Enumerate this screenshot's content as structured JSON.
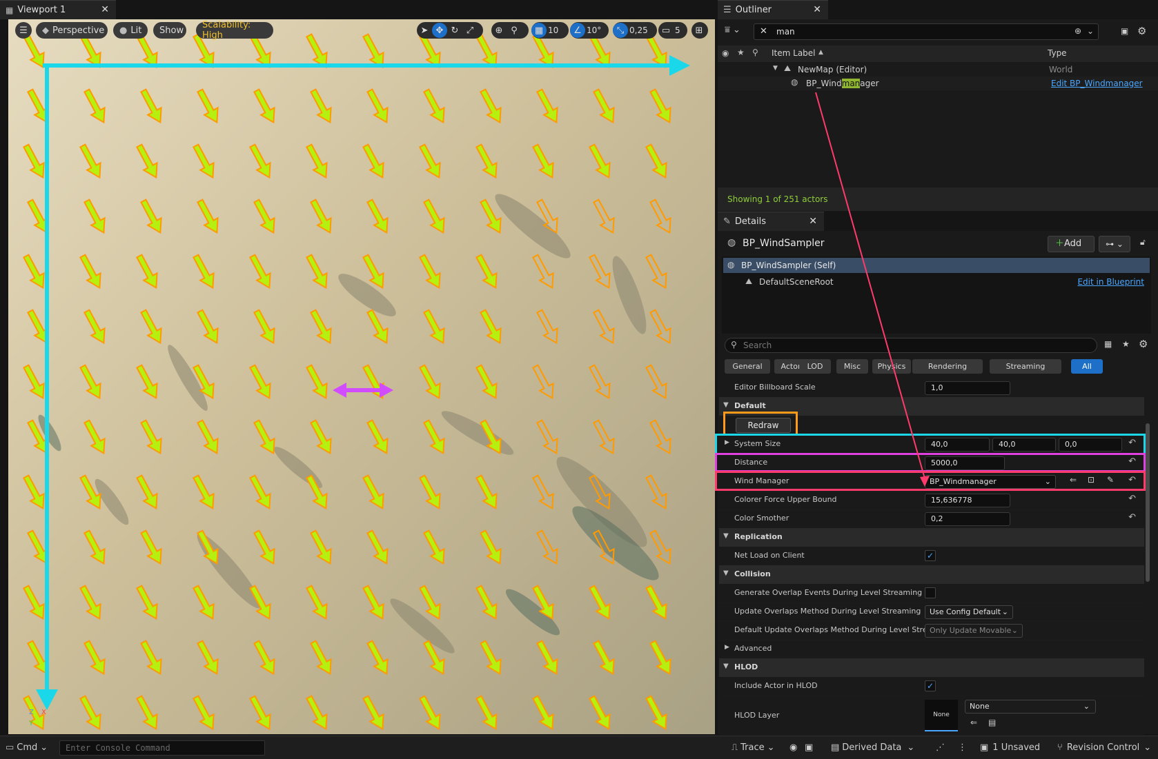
{
  "viewport": {
    "tab_title": "Viewport 1",
    "menu_icon": "hamburger-icon",
    "perspective_label": "Perspective",
    "lit_label": "Lit",
    "show_label": "Show",
    "scalability_label": "Scalability: High",
    "grid_snap_value": "10",
    "rotation_snap_value": "10°",
    "scale_snap_value": "0,25",
    "camera_speed_value": "5",
    "axis_labels": {
      "z": "Z",
      "x": "X",
      "y": "Y"
    },
    "arrow_colors": {
      "fill": "#b5f010",
      "outline": "#ff9a00",
      "cyan": "#1ad8ea",
      "magenta": "#d24cff"
    }
  },
  "outliner": {
    "tab_title": "Outliner",
    "search_value": "man",
    "col_item_label": "Item Label",
    "col_type": "Type",
    "rows": [
      {
        "label": "NewMap (Editor)",
        "type": "World"
      },
      {
        "label_pre": "BP_Wind",
        "label_match": "man",
        "label_post": "ager",
        "type": "Edit BP_Windmanager"
      }
    ],
    "count_text": "Showing 1 of 251 actors"
  },
  "details": {
    "tab_title": "Details",
    "object_name": "BP_WindSampler",
    "add_label": "Add",
    "components": [
      {
        "label": "BP_WindSampler (Self)"
      },
      {
        "label": "DefaultSceneRoot",
        "link": "Edit in Blueprint"
      }
    ],
    "search_placeholder": "Search",
    "filter_tabs": [
      "General",
      "Actor",
      "LOD",
      "Misc",
      "Physics",
      "Rendering",
      "Streaming",
      "All"
    ],
    "editor_billboard_scale": {
      "label": "Editor Billboard Scale",
      "value": "1,0"
    },
    "default_section": "Default",
    "redraw_label": "Redraw",
    "system_size": {
      "label": "System Size",
      "x": "40,0",
      "y": "40,0",
      "z": "0,0"
    },
    "distance": {
      "label": "Distance",
      "value": "5000,0"
    },
    "wind_manager": {
      "label": "Wind Manager",
      "value": "BP_Windmanager"
    },
    "colorer_force": {
      "label": "Colorer Force Upper Bound",
      "value": "15,636778"
    },
    "color_smother": {
      "label": "Color Smother",
      "value": "0,2"
    },
    "replication_section": "Replication",
    "net_load": {
      "label": "Net Load on Client",
      "checked": true
    },
    "collision_section": "Collision",
    "gen_overlap": {
      "label": "Generate Overlap Events During Level Streaming",
      "checked": false
    },
    "update_overlaps": {
      "label": "Update Overlaps Method During Level Streaming",
      "value": "Use Config Default"
    },
    "default_update_overlaps": {
      "label": "Default Update Overlaps Method During Level Stre...",
      "value": "Only Update Movable"
    },
    "advanced_label": "Advanced",
    "hlod_section": "HLOD",
    "include_hlod": {
      "label": "Include Actor in HLOD",
      "checked": true
    },
    "hlod_layer": {
      "label": "HLOD Layer",
      "thumb": "None",
      "value": "None"
    }
  },
  "statusbar": {
    "cmd_label": "Cmd",
    "console_placeholder": "Enter Console Command",
    "trace_label": "Trace",
    "derived_data_label": "Derived Data",
    "unsaved_label": "1 Unsaved",
    "revision_label": "Revision Control"
  },
  "highlight_colors": {
    "orange": "#ff9a1a",
    "cyan": "#1ad8ea",
    "magenta": "#e040e0",
    "red": "#ff3b6b"
  }
}
